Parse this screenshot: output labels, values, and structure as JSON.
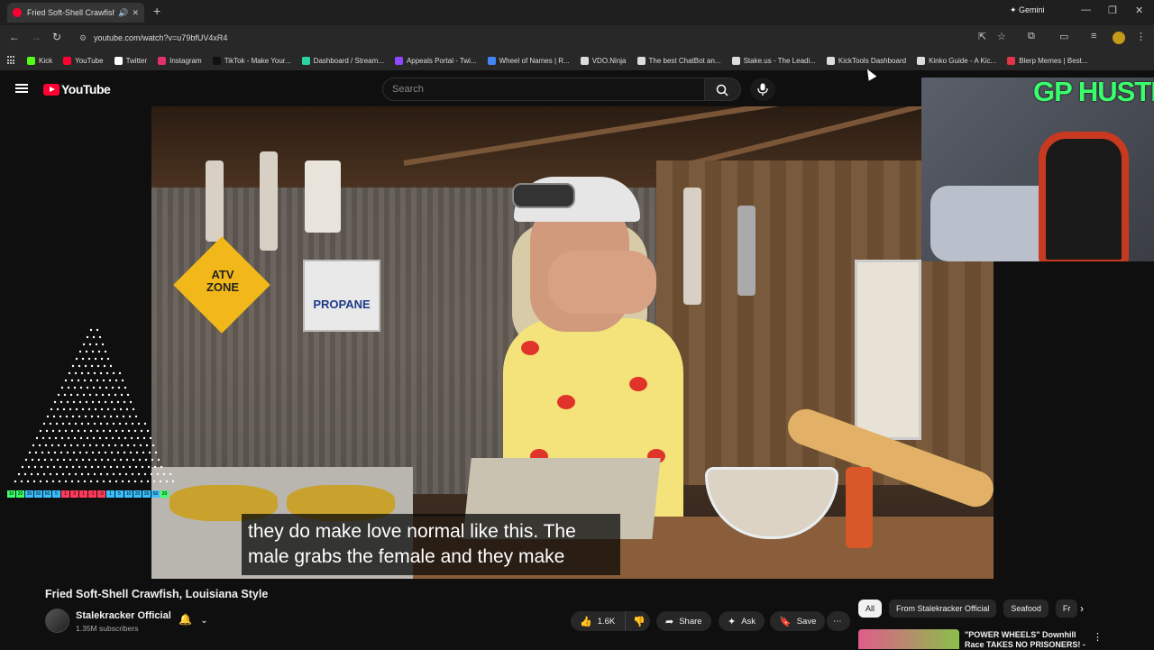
{
  "browser": {
    "tab_title": "Fried Soft-Shell Crawfish, Lo",
    "tab_audio_icon": "speaker-icon",
    "new_tab": "+",
    "gemini_label": "Gemini",
    "url": "youtube.com/watch?v=u79bfUV4xR4",
    "bookmarks": [
      {
        "label": "Kick",
        "color": "#53fc18"
      },
      {
        "label": "YouTube",
        "color": "#ff0033"
      },
      {
        "label": "Twitter",
        "color": "#ffffff"
      },
      {
        "label": "Instagram",
        "color": "#e1306c"
      },
      {
        "label": "TikTok - Make Your...",
        "color": "#111111"
      },
      {
        "label": "Dashboard / Stream...",
        "color": "#2ad4a0"
      },
      {
        "label": "Appeals Portal - Twi...",
        "color": "#9146ff"
      },
      {
        "label": "Wheel of Names | R...",
        "color": "#4285f4"
      },
      {
        "label": "VDO.Ninja",
        "color": "#dddddd"
      },
      {
        "label": "The best ChatBot an...",
        "color": "#dddddd"
      },
      {
        "label": "Stake.us - The Leadi...",
        "color": "#dddddd"
      },
      {
        "label": "KickTools Dashboard",
        "color": "#dddddd"
      },
      {
        "label": "Kinko Guide - A Kic...",
        "color": "#dddddd"
      },
      {
        "label": "Blerp Memes | Best...",
        "color": "#e0344a"
      }
    ]
  },
  "youtube": {
    "logo_text": "YouTube",
    "search_placeholder": "Search"
  },
  "video": {
    "caption_line1": "they do make love normal like this. The",
    "caption_line2": "male grabs the female and they make",
    "sign_atv": "ATV ZONE",
    "sign_propane": "PROPANE"
  },
  "overlay": {
    "hustle_text": "GP HUSTLA",
    "bars": [
      "10",
      "20",
      "35",
      "50",
      "60",
      "5",
      "1",
      "3",
      "1",
      "-1",
      "-3",
      "1",
      "5",
      "10",
      "20",
      "35",
      "50",
      "20"
    ]
  },
  "meta": {
    "title": "Fried Soft-Shell Crawfish, Louisiana Style",
    "channel": "Stalekracker Official",
    "subscribers": "1.35M subscribers",
    "likes": "1.6K",
    "share": "Share",
    "ask": "Ask",
    "save": "Save"
  },
  "related": {
    "chips": [
      "All",
      "From Stalekracker Official",
      "Seafood",
      "Fr"
    ],
    "first_title": "\"POWER WHEELS\" Downhill Race TAKES NO PRISONERS! -"
  }
}
